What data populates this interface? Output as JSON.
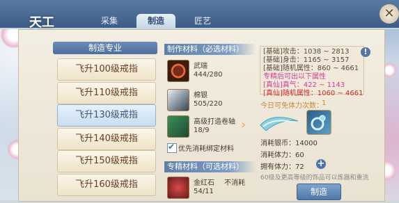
{
  "header": {
    "logo_text": "天工",
    "tabs": [
      {
        "label": "采集",
        "active": false
      },
      {
        "label": "制造",
        "active": true
      },
      {
        "label": "匠艺",
        "active": false
      }
    ],
    "close_label": "✕"
  },
  "recipe_list": {
    "heading": "制造专业",
    "items": [
      {
        "label": "飞升100级戒指",
        "selected": false
      },
      {
        "label": "飞升110级戒指",
        "selected": false
      },
      {
        "label": "飞升130级戒指",
        "selected": true
      },
      {
        "label": "飞升140级戒指",
        "selected": false
      },
      {
        "label": "飞升150级戒指",
        "selected": false
      },
      {
        "label": "飞升160级戒指",
        "selected": false
      }
    ]
  },
  "materials": {
    "required_heading": "制作材料（必选材料）",
    "required": [
      {
        "name": "武瑞",
        "count": "444/280",
        "icon": "ring-icon"
      },
      {
        "name": "棉银",
        "count": "505/220",
        "icon": "silver-ore-icon"
      },
      {
        "name": "高级打造卷轴",
        "count": "18/9",
        "icon": "scroll-icon"
      }
    ],
    "prefer_bound_label": "优先消耗绑定材料",
    "optional_heading": "专精材料（可选材料）",
    "optional": [
      {
        "name": "金红石",
        "extra": "不消耗",
        "count": "54/11",
        "icon": "rutile-icon"
      }
    ]
  },
  "stats": {
    "lines": [
      {
        "text": "[基础]攻击：1038 ~ 2813",
        "tone": "normal"
      },
      {
        "text": "[基础]身击：1165 ~ 3157",
        "tone": "normal"
      },
      {
        "text": "[基础]随机属性：860 ~ 4661",
        "tone": "normal"
      },
      {
        "text": "专精后可出以下属性",
        "tone": "pink"
      },
      {
        "text": "[真仙]真气：422 ~ 1143",
        "tone": "pink"
      },
      {
        "text": "[真仙]随机属性：1060 ~ 4661",
        "tone": "red"
      }
    ],
    "info_icon_label": "!"
  },
  "craft": {
    "today_label": "今日可免体力次数：",
    "today_value": "1",
    "silver_label": "消耗银币：14000",
    "stamina_cost_label": "消耗体力：60",
    "stamina_have_label": "拥有体力：72",
    "note": "60级及更高等级的饰品可以炼器和重洗",
    "button_label": "制造"
  }
}
